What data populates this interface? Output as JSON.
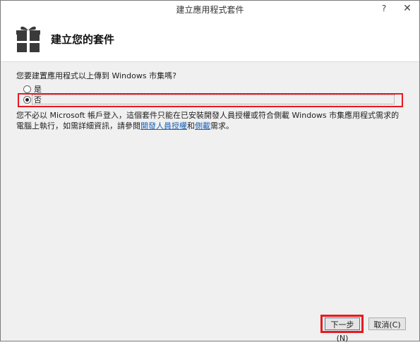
{
  "window": {
    "title": "建立應用程式套件",
    "help_label": "?",
    "close_label": "✕"
  },
  "header": {
    "title": "建立您的套件",
    "icon": "gift-icon"
  },
  "question": "您要建置應用程式以上傳到 Windows 市集嗎?",
  "options": {
    "yes_label": "是",
    "no_label": "否",
    "selected": "否"
  },
  "info": {
    "text_before": "您不必以 Microsoft 帳戶登入，這個套件只能在已安裝開發人員授權或符合側載 Windows 市集應用程式需求的電腦上執行，如需詳細資訊，請參閱",
    "link1": "開發人員授權",
    "text_mid": "和",
    "link2": "側載",
    "text_after": "需求。"
  },
  "buttons": {
    "next_label": "下一步(N)",
    "cancel_label": "取消(C)"
  },
  "colors": {
    "highlight": "#e8191f",
    "link": "#1a5fb4"
  }
}
